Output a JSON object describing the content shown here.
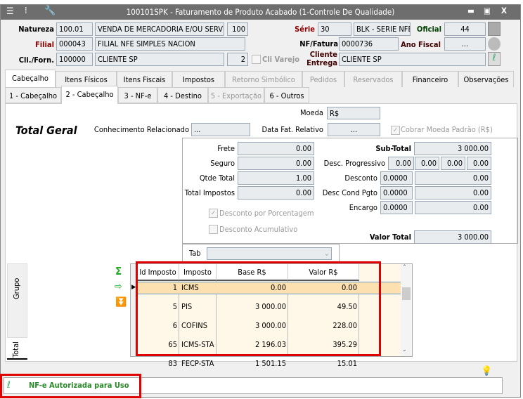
{
  "window": {
    "title": "100101SPK - Faturamento de Produto Acabado (1-Controle De Qualidade)",
    "controls": [
      "minimize",
      "restore",
      "close"
    ]
  },
  "header": {
    "natureza": {
      "label": "Natureza",
      "code": "100.01",
      "desc": "VENDA DE MERCADORIA E/OU SERVI",
      "num": "100"
    },
    "filial": {
      "label": "Filial",
      "code": "000043",
      "desc": "FILIAL NFE SIMPLES NACION"
    },
    "cliforn": {
      "label": "Cli./Forn.",
      "code": "100000",
      "desc": "CLIENTE SP",
      "num": "2",
      "varejo_label": "Cli Varejo"
    },
    "serie": {
      "label": "Série",
      "code": "30",
      "desc": "BLK - SERIE NFE"
    },
    "oficial": {
      "label": "Oficial",
      "value": "44"
    },
    "nf": {
      "label": "NF/Fatura",
      "value": "0000736"
    },
    "ano_fiscal": {
      "label": "Ano Fiscal",
      "value": "..."
    },
    "cliente_entrega": {
      "label1": "Cliente",
      "label2": "Entrega",
      "value": "CLIENTE SP"
    }
  },
  "tabs": [
    "Cabeçalho",
    "Itens Físicos",
    "Itens Fiscais",
    "Impostos",
    "Retorno Simbólico",
    "Pedidos",
    "Reservados",
    "Financeiro",
    "Observações"
  ],
  "subtabs": [
    "1 - Cabeçalho",
    "2 - Cabeçalho",
    "3 - NF-e",
    "4 - Destino",
    "5 - Exportação",
    "6 - Outros"
  ],
  "main": {
    "moeda_label": "Moeda",
    "moeda": "R$",
    "total_geral": "Total Geral",
    "conhecimento_label": "Conhecimento Relacionado",
    "conhecimento": "...",
    "data_fat_label": "Data Fat. Relativo",
    "data_fat": "...",
    "cobrar_label": "Cobrar Moeda Padrão (R$)",
    "frete_label": "Frete",
    "frete": "0.00",
    "seguro_label": "Seguro",
    "seguro": "0.00",
    "qtde_label": "Qtde Total",
    "qtde": "1.00",
    "impostos_label": "Total Impostos",
    "impostos": "0.00",
    "subtotal_label": "Sub-Total",
    "subtotal": "3 000.00",
    "descprog_label": "Desc. Progressivo",
    "descprog": [
      "0.00",
      "0.00",
      "0.00",
      "0.00"
    ],
    "desconto_label": "Desconto",
    "desconto_pct": "0.0000",
    "desconto": "0.00",
    "desccond_label": "Desc Cond Pgto",
    "desccond_pct": "0.0000",
    "desccond": "0.00",
    "encargo_label": "Encargo",
    "encargo_pct": "0.0000",
    "encargo": "0.00",
    "desc_pct_label": "Desconto por Porcentagem",
    "desc_acum_label": "Desconto Acumulativo",
    "valortotal_label": "Valor Total",
    "valortotal": "3 000.00",
    "tab_label": "Tab"
  },
  "side_tabs": [
    "Grupo",
    "Total"
  ],
  "grid": {
    "columns": [
      "Id Imposto",
      "Imposto",
      "Base R$",
      "Valor R$"
    ],
    "rows": [
      [
        "1",
        "ICMS",
        "0.00",
        "0.00"
      ],
      [
        "5",
        "PIS",
        "3 000.00",
        "49.50"
      ],
      [
        "6",
        "COFINS",
        "3 000.00",
        "228.00"
      ],
      [
        "65",
        "ICMS-STA",
        "2 196.03",
        "395.29"
      ],
      [
        "83",
        "FECP-STA",
        "1 501.15",
        "15.01"
      ]
    ]
  },
  "status": {
    "text": "NF-e Autorizada para Uso",
    "color": "#2a8a2a"
  }
}
